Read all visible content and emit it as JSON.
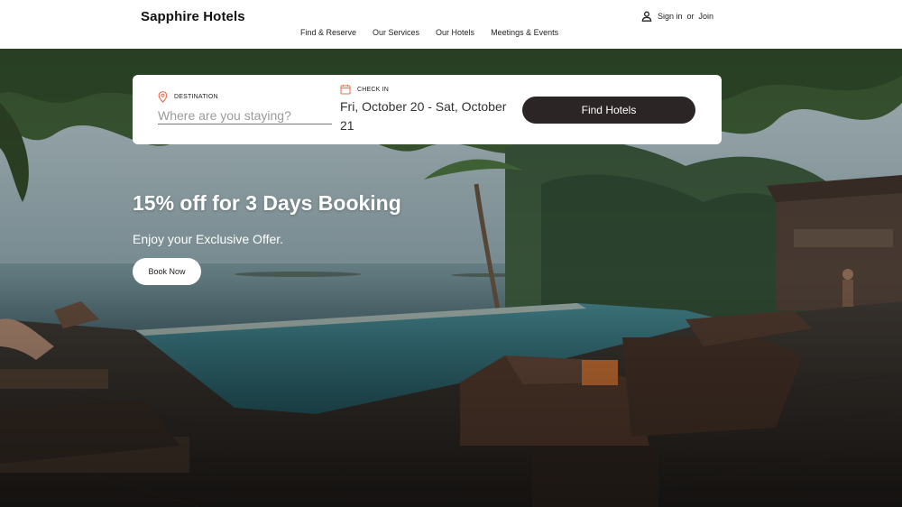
{
  "brand": {
    "name": "Sapphire Hotels"
  },
  "nav": {
    "items": [
      {
        "label": "Find & Reserve"
      },
      {
        "label": "Our Services"
      },
      {
        "label": "Our Hotels"
      },
      {
        "label": "Meetings & Events"
      }
    ]
  },
  "account": {
    "sign_in": "Sign in",
    "or": "or",
    "join": "Join",
    "icon": "user-icon"
  },
  "search": {
    "destination_label": "DESTINATION",
    "destination_placeholder": "Where are you staying?",
    "destination_value": "",
    "destination_icon": "location-pin-icon",
    "checkin_label": "CHECK IN",
    "checkin_value": "Fri, October 20 - Sat, October 21",
    "checkin_icon": "calendar-icon",
    "submit_label": "Find Hotels"
  },
  "promo": {
    "title": "15% off for 3 Days Booking",
    "subtitle": "Enjoy your Exclusive Offer.",
    "cta_label": "Book Now"
  },
  "colors": {
    "accent_icon": "#e8735a",
    "button_dark": "#2b2525",
    "card_bg": "#ffffff"
  }
}
